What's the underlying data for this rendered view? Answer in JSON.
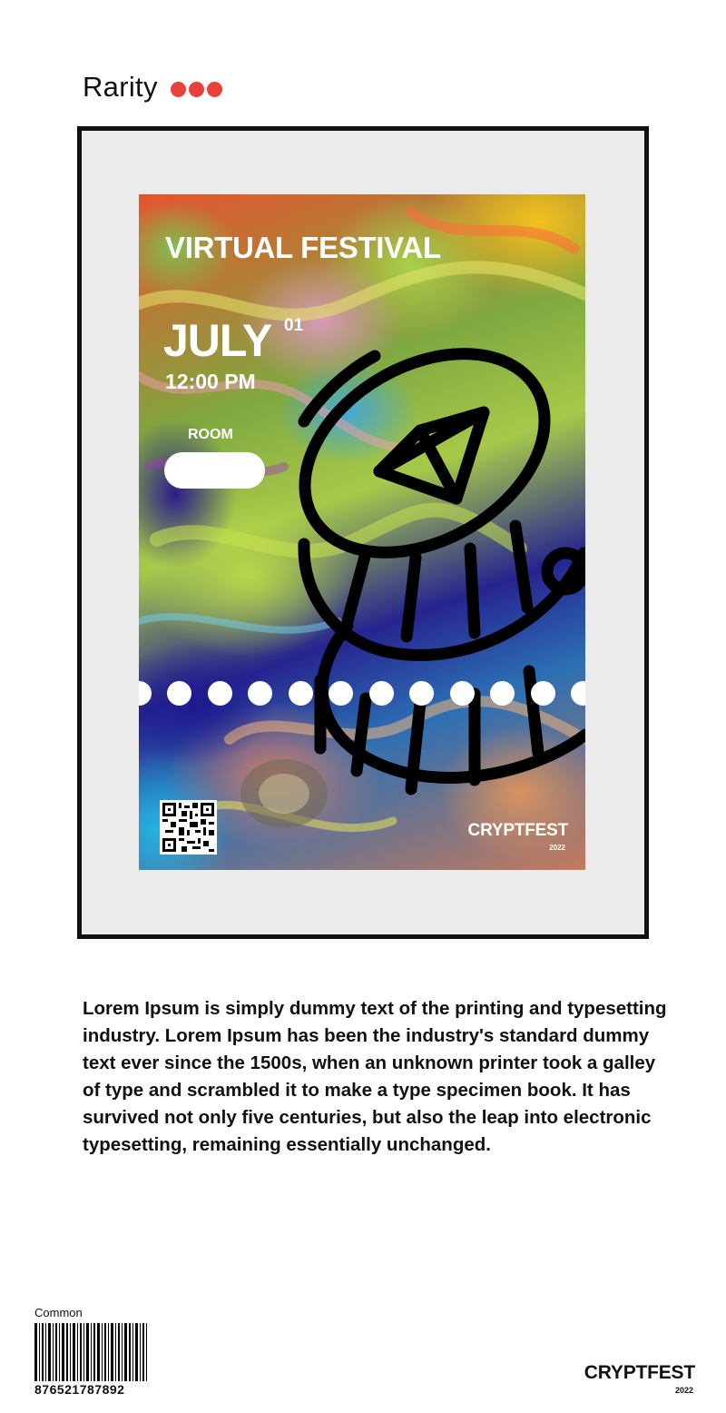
{
  "rarity": {
    "label": "Rarity",
    "level": 3,
    "dot_color": "#e8403a"
  },
  "ticket": {
    "title": "VIRTUAL FESTIVAL",
    "month": "JULY",
    "day": "01",
    "time": "12:00 PM",
    "room_label": "ROOM",
    "room_value": "",
    "brand": "CRYPTFEST",
    "year": "2022",
    "icons": [
      "ethereum-coin-icon",
      "qr-code-icon"
    ]
  },
  "description": "Lorem Ipsum is simply dummy text of the printing and typesetting industry. Lorem Ipsum has been the industry's standard dummy text ever since the 1500s, when an unknown printer took a galley of type and scrambled it to make a type specimen book. It has survived not only five centuries, but also the leap into electronic typesetting, remaining essentially unchanged.",
  "footer": {
    "rarity_tier": "Common",
    "barcode_number": "876521787892",
    "brand": "CRYPTFEST",
    "year": "2022"
  }
}
